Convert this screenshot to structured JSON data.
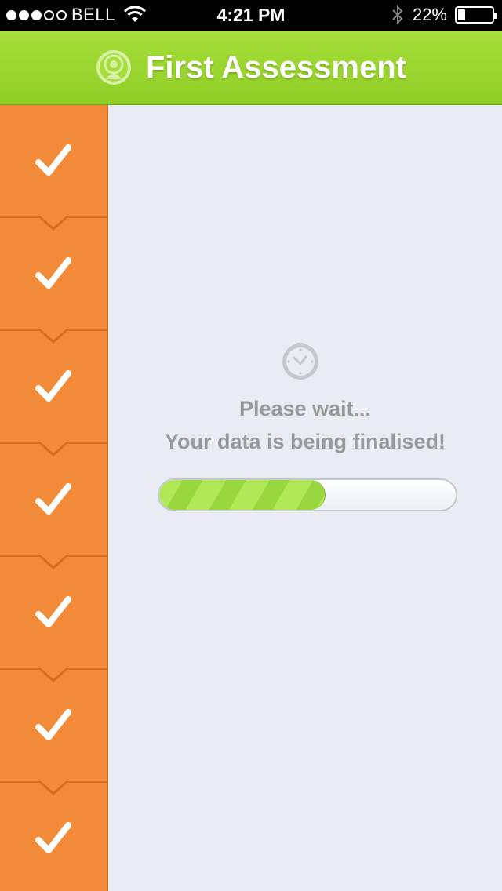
{
  "status_bar": {
    "carrier": "BELL",
    "time": "4:21 PM",
    "battery_text": "22%",
    "battery_level": 0.22,
    "signal_strength": 3,
    "signal_total": 5
  },
  "header": {
    "title": "First Assessment",
    "logo_icon": "user-badge-icon"
  },
  "sidebar": {
    "steps": [
      {
        "status": "complete",
        "icon": "checkmark-icon"
      },
      {
        "status": "complete",
        "icon": "checkmark-icon"
      },
      {
        "status": "complete",
        "icon": "checkmark-icon"
      },
      {
        "status": "complete",
        "icon": "checkmark-icon"
      },
      {
        "status": "complete",
        "icon": "checkmark-icon"
      },
      {
        "status": "complete",
        "icon": "checkmark-icon"
      },
      {
        "status": "complete",
        "icon": "checkmark-icon"
      }
    ]
  },
  "main": {
    "icon": "clock-icon",
    "line1": "Please wait...",
    "line2": "Your data is being finalised!",
    "progress": 0.56
  },
  "colors": {
    "header_green": "#a6de3a",
    "sidebar_orange": "#f28a3a",
    "background": "#e9ecf2",
    "text_gray": "#999999"
  }
}
